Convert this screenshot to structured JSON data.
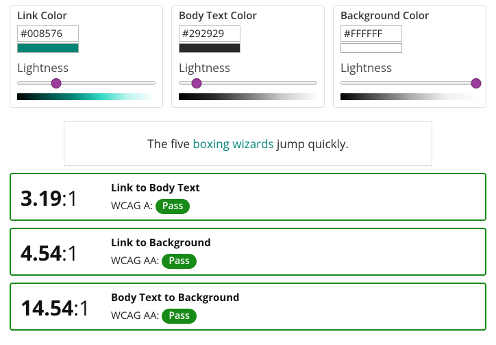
{
  "panels": {
    "link": {
      "title": "Link Color",
      "value": "#008576",
      "lightness_label": "Lightness",
      "slider_pct": 28
    },
    "body": {
      "title": "Body Text Color",
      "value": "#292929",
      "lightness_label": "Lightness",
      "slider_pct": 13
    },
    "bg": {
      "title": "Background Color",
      "value": "#FFFFFF",
      "lightness_label": "Lightness",
      "slider_pct": 98
    }
  },
  "preview": {
    "before": "The five ",
    "link": "boxing wizards",
    "after": " jump quickly."
  },
  "results": [
    {
      "ratio": "3.19",
      "suffix": ":1",
      "title": "Link to Body Text",
      "level_label": "WCAG A: ",
      "status": "Pass"
    },
    {
      "ratio": "4.54",
      "suffix": ":1",
      "title": "Link to Background",
      "level_label": "WCAG AA: ",
      "status": "Pass"
    },
    {
      "ratio": "14.54",
      "suffix": ":1",
      "title": "Body Text to Background",
      "level_label": "WCAG AA: ",
      "status": "Pass"
    }
  ]
}
